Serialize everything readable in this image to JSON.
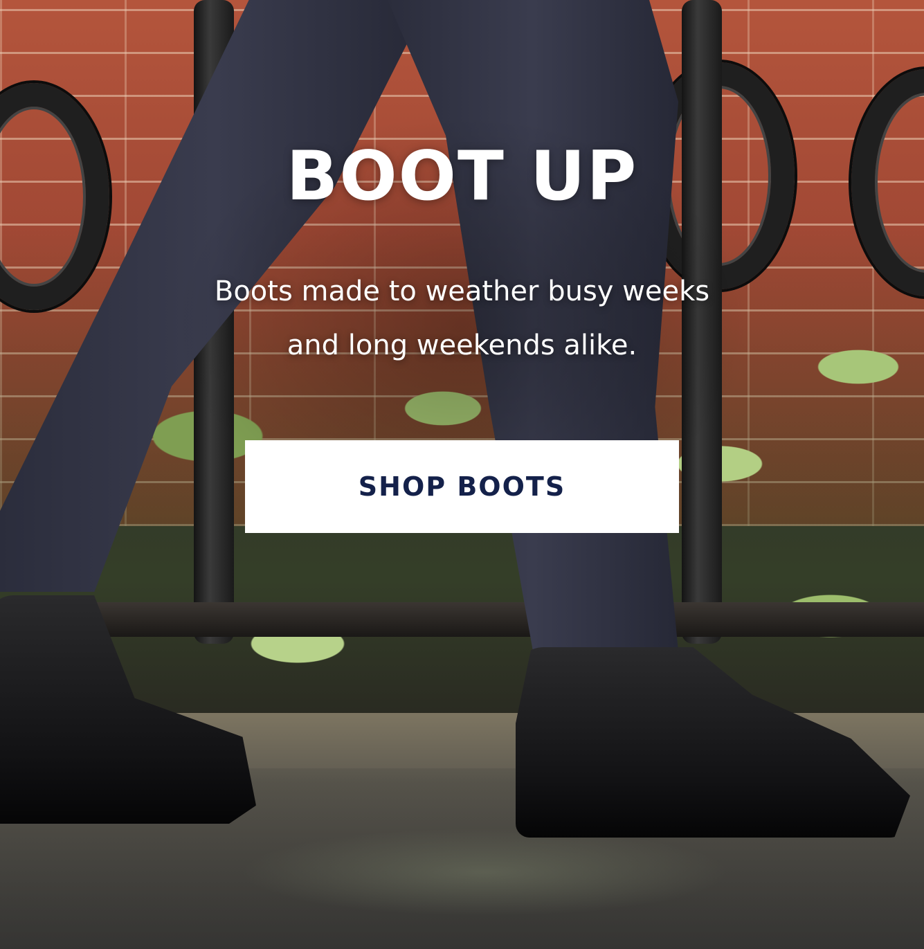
{
  "hero": {
    "headline": "BOOT UP",
    "subhead_line1": "Boots made to weather busy weeks",
    "subhead_line2": "and long weekends alike.",
    "cta_label": "SHOP BOOTS"
  },
  "colors": {
    "headline_text": "#ffffff",
    "cta_background": "#ffffff",
    "cta_text": "#14214a"
  }
}
